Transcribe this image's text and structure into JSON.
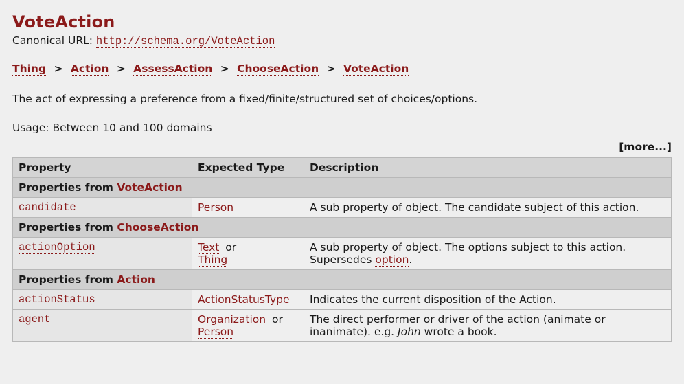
{
  "heading": "VoteAction",
  "canonical_label": "Canonical URL: ",
  "canonical_url": "http://schema.org/VoteAction",
  "breadcrumb": [
    "Thing",
    "Action",
    "AssessAction",
    "ChooseAction",
    "VoteAction"
  ],
  "description_text": "The act of expressing a preference from a fixed/finite/structured set of choices/options.",
  "usage_text": "Usage: Between 10 and 100 domains",
  "more_label": "[more...]",
  "table": {
    "headers": {
      "property": "Property",
      "expected": "Expected Type",
      "description": "Description"
    },
    "section1_title_prefix": "Properties from ",
    "section1_title_link": "VoteAction",
    "row_candidate": {
      "prop": "candidate",
      "types": [
        "Person"
      ],
      "desc": "A sub property of object. The candidate subject of this action."
    },
    "section2_title_prefix": "Properties from ",
    "section2_title_link": "ChooseAction",
    "row_actionOption": {
      "prop": "actionOption",
      "types": [
        "Text",
        "Thing"
      ],
      "desc_prefix": "A sub property of object. The options subject to this action. Supersedes ",
      "desc_link": "option",
      "desc_suffix": "."
    },
    "section3_title_prefix": "Properties from ",
    "section3_title_link": "Action",
    "row_actionStatus": {
      "prop": "actionStatus",
      "types": [
        "ActionStatusType"
      ],
      "desc": "Indicates the current disposition of the Action."
    },
    "row_agent": {
      "prop": "agent",
      "types": [
        "Organization",
        "Person"
      ],
      "desc_pre": "The direct performer or driver of the action (animate or inanimate). e.g. ",
      "desc_em": "John",
      "desc_post": " wrote a book."
    },
    "or_label": " or"
  }
}
